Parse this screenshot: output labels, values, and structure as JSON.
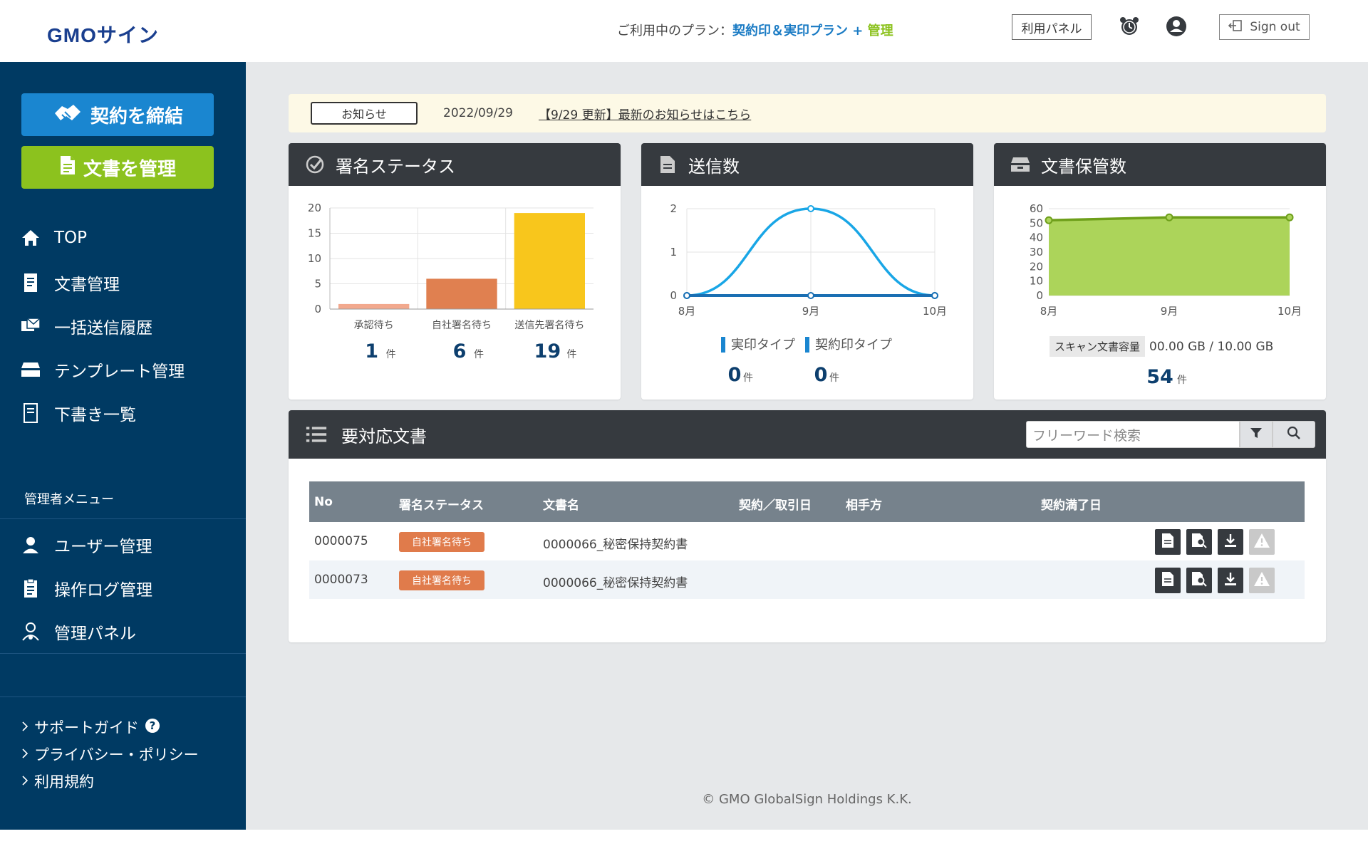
{
  "header": {
    "logo_text": "GMOサイン",
    "plan_prefix": "ご利用中のプラン：",
    "plan_name": "契約印＆実印プラン",
    "plan_plus": " + ",
    "plan_suffix": "管理",
    "panel_button": "利用パネル",
    "signout_button": "Sign out"
  },
  "sidebar": {
    "cta_contract": "契約を締結",
    "cta_docs": "文書を管理",
    "nav": [
      {
        "label": "TOP",
        "icon": "home-icon"
      },
      {
        "label": "文書管理",
        "icon": "document-list-icon"
      },
      {
        "label": "一括送信履歴",
        "icon": "bulk-send-icon"
      },
      {
        "label": "テンプレート管理",
        "icon": "template-box-icon"
      },
      {
        "label": "下書き一覧",
        "icon": "draft-icon"
      }
    ],
    "admin_label": "管理者メニュー",
    "admin_nav": [
      {
        "label": "ユーザー管理",
        "icon": "user-icon"
      },
      {
        "label": "操作ログ管理",
        "icon": "log-icon"
      },
      {
        "label": "管理パネル",
        "icon": "admin-panel-icon"
      }
    ],
    "footer_links": [
      {
        "label": "サポートガイド"
      },
      {
        "label": "プライバシー・ポリシー"
      },
      {
        "label": "利用規約"
      }
    ]
  },
  "notice": {
    "badge": "お知らせ",
    "date": "2022/09/29",
    "link": "【9/29 更新】最新のお知らせはこちら"
  },
  "cards": {
    "status": {
      "title": "署名ステータス"
    },
    "sent": {
      "title": "送信数"
    },
    "storage": {
      "title": "文書保管数"
    }
  },
  "chart_data": [
    {
      "type": "bar",
      "title": "署名ステータス",
      "categories": [
        "承認待ち",
        "自社署名待ち",
        "送信先署名待ち"
      ],
      "values": [
        1,
        6,
        19
      ],
      "colors": [
        "#f2a98e",
        "#e08050",
        "#f8c61c"
      ],
      "yticks": [
        0,
        5,
        10,
        15,
        20
      ],
      "ylim": [
        0,
        20
      ],
      "count_labels": [
        "1",
        "6",
        "19"
      ],
      "unit": "件"
    },
    {
      "type": "line",
      "title": "送信数",
      "x": [
        "8月",
        "9月",
        "10月"
      ],
      "series": [
        {
          "name": "実印タイプ",
          "values": [
            0,
            2,
            0
          ],
          "color": "#19a6e6"
        },
        {
          "name": "契約印タイプ",
          "values": [
            0,
            0,
            0
          ],
          "color": "#1a6fb3"
        }
      ],
      "yticks": [
        0,
        1,
        2
      ],
      "ylim": [
        0,
        2
      ],
      "count_labels": [
        "0",
        "0"
      ],
      "unit": "件"
    },
    {
      "type": "area",
      "title": "文書保管数",
      "x": [
        "8月",
        "9月",
        "10月"
      ],
      "values": [
        52,
        54,
        54
      ],
      "color": "#8cc21e",
      "yticks": [
        0,
        10,
        20,
        30,
        40,
        50,
        60
      ],
      "ylim": [
        0,
        60
      ],
      "scan_label": "スキャン文書容量",
      "scan_value": "00.00 GB / 10.00 GB",
      "count_label": "54",
      "unit": "件"
    }
  ],
  "actions": {
    "title": "要対応文書",
    "search_placeholder": "フリーワード検索",
    "columns": [
      "No",
      "署名ステータス",
      "文書名",
      "契約／取引日",
      "相手方",
      "契約満了日"
    ],
    "rows": [
      {
        "no": "0000075",
        "status": "自社署名待ち",
        "doc": "0000066_秘密保持契約書"
      },
      {
        "no": "0000073",
        "status": "自社署名待ち",
        "doc": "0000066_秘密保持契約書"
      }
    ]
  },
  "footer": {
    "copyright": "© GMO GlobalSign Holdings K.K."
  }
}
